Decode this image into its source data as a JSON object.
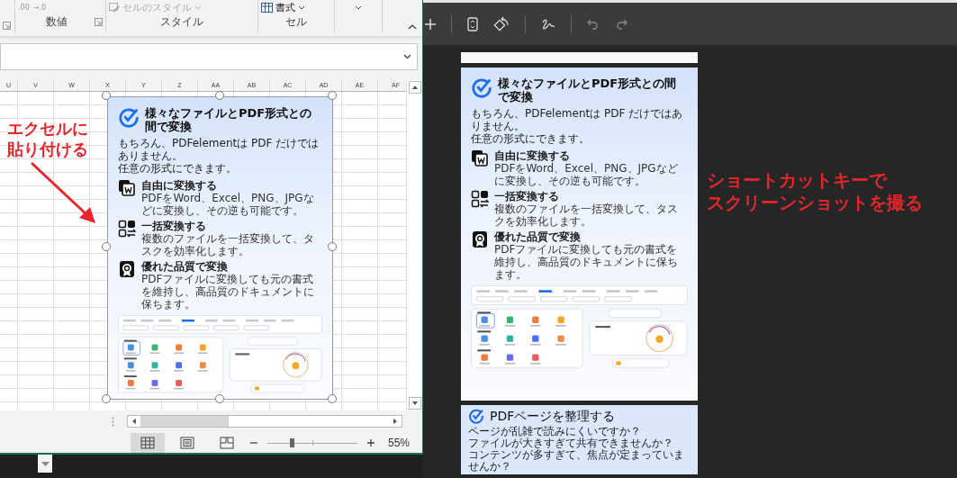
{
  "excel": {
    "ribbon": {
      "number_buttons": [
        ".00",
        "→.0"
      ],
      "cell_styles_button": "セルのスタイル",
      "format_button": "書式",
      "groups": [
        "数値",
        "スタイル",
        "セル"
      ]
    },
    "columns": [
      "U",
      "V",
      "W",
      "X",
      "Y",
      "Z",
      "AA",
      "AB",
      "AC",
      "AD",
      "AE",
      "AF"
    ],
    "pasted_image": {
      "kind": "convert",
      "title": "様々なファイルとPDF形式との間で変換",
      "intro": [
        "もちろん、PDFelementは PDF だけではありません。",
        "任意の形式にできます。"
      ],
      "features": [
        {
          "kind": "word",
          "title": "自由に変換する",
          "text": "PDFをWord、Excel、PNG、JPGなどに変換し、その逆も可能です。"
        },
        {
          "kind": "batch",
          "title": "一括変換する",
          "text": "複数のファイルを一括変換して、タスクを効率化します。"
        },
        {
          "kind": "quality",
          "title": "優れた品質で変換",
          "text": "PDFファイルに変換しても元の書式を維持し、高品質のドキュメントに保ちます。"
        }
      ]
    },
    "views": [
      {
        "kind": "normal",
        "selected": true
      },
      {
        "kind": "page_layout",
        "selected": false
      },
      {
        "kind": "page_break",
        "selected": false
      }
    ],
    "zoom": {
      "level": 0.27,
      "reading": "55%"
    }
  },
  "notes": {
    "left": "エクセルに貼り付ける",
    "right": [
      "ショートカットキーで",
      "スクリーンショットを撮る"
    ]
  },
  "viewer": {
    "pages": [
      {
        "kind": "convert",
        "title": "様々なファイルとPDF形式との間で変換",
        "intro": [
          "もちろん、PDFelementは PDF だけではありません。",
          "任意の形式にできます。"
        ],
        "features": [
          {
            "kind": "word",
            "title": "自由に変換する",
            "text": "PDFをWord、Excel、PNG、JPGなどに変換し、その逆も可能です。"
          },
          {
            "kind": "batch",
            "title": "一括変換する",
            "text": "複数のファイルを一括変換して、タスクを効率化します。"
          },
          {
            "kind": "quality",
            "title": "優れた品質で変換",
            "text": "PDFファイルに変換しても元の書式を維持し、高品質のドキュメントに保ちます。"
          }
        ]
      },
      {
        "kind": "organize",
        "title": "PDFページを整理する",
        "intro": [
          "ページが乱雑で読みにくいですか？",
          "ファイルが大きすぎて共有できませんか？",
          "コンテンツが多すぎて、焦点が定まっていませんか？"
        ]
      }
    ]
  }
}
